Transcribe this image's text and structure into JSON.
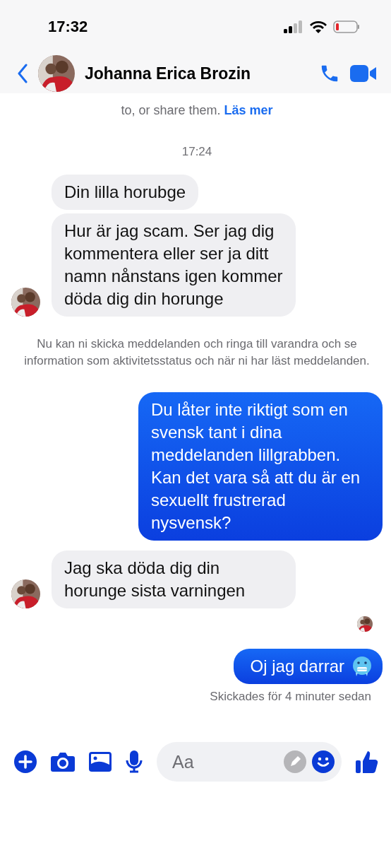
{
  "status_bar": {
    "time": "17:32"
  },
  "header": {
    "name": "Johanna Erica Brozin"
  },
  "top_notice": {
    "text": "to, or share them.",
    "link": "Läs mer"
  },
  "messages": [
    {
      "kind": "time",
      "text": "17:24"
    },
    {
      "kind": "incoming",
      "text": "Din lilla horubge",
      "avatar": false
    },
    {
      "kind": "incoming",
      "text": "Hur är jag scam. Ser jag dig kommentera eller ser ja ditt namn nånstans igen kommer döda dig din horunge",
      "avatar": true
    },
    {
      "kind": "notice",
      "text": "Nu kan ni skicka meddelanden och ringa till varandra och se information som aktivitetsstatus och när ni har läst meddelanden."
    },
    {
      "kind": "outgoing",
      "text": "Du låter inte riktigt som en svensk tant i dina meddelanden lillgrabben. Kan det vara så att du är en sexuellt frustrerad nysvensk?",
      "emoji": false
    },
    {
      "kind": "incoming",
      "text": "Jag ska döda dig din horunge sista varningen",
      "avatar": true
    },
    {
      "kind": "read"
    },
    {
      "kind": "outgoing",
      "text": "Oj jag darrar",
      "emoji": true
    },
    {
      "kind": "status",
      "text": "Skickades för 4 minuter sedan"
    }
  ],
  "composer": {
    "placeholder": "Aa"
  }
}
